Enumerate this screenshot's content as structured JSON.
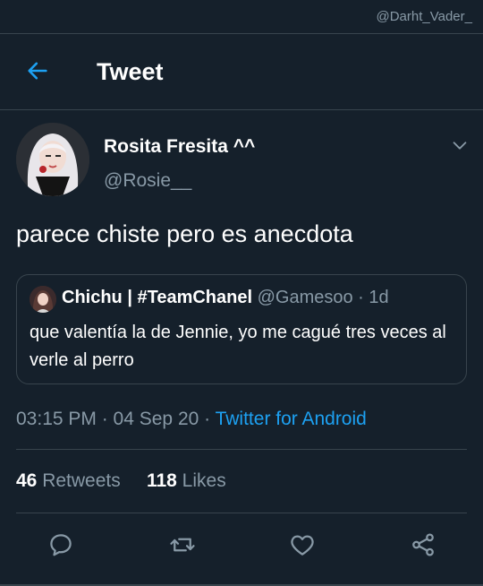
{
  "watermark": "@Darht_Vader_",
  "header": {
    "title": "Tweet",
    "back_icon": "arrow-left-icon"
  },
  "tweet": {
    "author_name": "Rosita Fresita ^^",
    "author_handle": "@Rosie__",
    "text": "parece chiste pero es anecdota",
    "timestamp": "03:15 PM · 04 Sep 20 · ",
    "source": "Twitter for Android"
  },
  "quote": {
    "name": "Chichu | #TeamChanel",
    "handle": "@Gamesoo · 1d",
    "text": "que valentía la de Jennie, yo me cagué tres veces al verle al perro"
  },
  "stats": {
    "retweets_count": "46",
    "retweets_label": "Retweets",
    "likes_count": "118",
    "likes_label": "Likes"
  },
  "actions": [
    "reply-icon",
    "retweet-icon",
    "like-icon",
    "share-icon"
  ],
  "colors": {
    "background": "#15202b",
    "accent": "#1da1f2",
    "muted": "#8899a6",
    "border": "#38444d"
  }
}
